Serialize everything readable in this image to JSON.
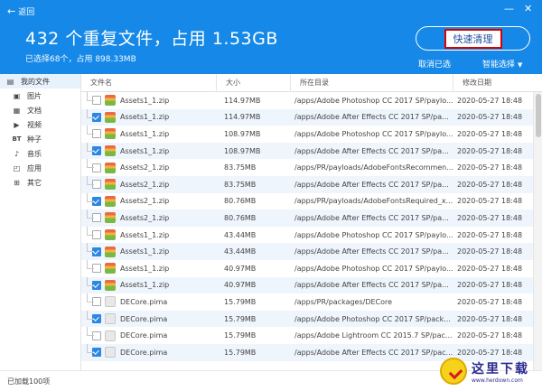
{
  "header": {
    "back_label": "返回",
    "title": "432 个重复文件，占用 1.53GB",
    "subtitle": "已选择68个，占用 898.33MB",
    "quick_clean_label": "快速清理",
    "cancel_selection_label": "取消已选",
    "smart_select_label": "智能选择",
    "window_controls": [
      "minimize-icon",
      "close-icon"
    ]
  },
  "sidebar": {
    "items": [
      {
        "icon": "my-files-icon",
        "label": "我的文件"
      },
      {
        "icon": "image-icon",
        "label": "图片"
      },
      {
        "icon": "document-icon",
        "label": "文档"
      },
      {
        "icon": "video-icon",
        "label": "视频"
      },
      {
        "icon": "bt-icon",
        "icon_text": "BT",
        "label": "种子"
      },
      {
        "icon": "music-icon",
        "label": "音乐"
      },
      {
        "icon": "app-icon",
        "label": "应用"
      },
      {
        "icon": "other-icon",
        "label": "其它"
      }
    ]
  },
  "table": {
    "columns": [
      "文件名",
      "大小",
      "所在目录",
      "修改日期"
    ],
    "rows": [
      {
        "name": "Assets1_1.zip",
        "size": "114.97MB",
        "path": "/apps/Adobe Photoshop CC 2017 SP/paylo...",
        "date": "2020-05-27 18:48",
        "checked": false,
        "type": "zip"
      },
      {
        "name": "Assets1_1.zip",
        "size": "114.97MB",
        "path": "/apps/Adobe After Effects CC 2017 SP/pa...",
        "date": "2020-05-27 18:48",
        "checked": true,
        "type": "zip"
      },
      {
        "name": "Assets1_1.zip",
        "size": "108.97MB",
        "path": "/apps/Adobe Photoshop CC 2017 SP/paylo...",
        "date": "2020-05-27 18:48",
        "checked": false,
        "type": "zip"
      },
      {
        "name": "Assets1_1.zip",
        "size": "108.97MB",
        "path": "/apps/Adobe After Effects CC 2017 SP/pa...",
        "date": "2020-05-27 18:48",
        "checked": true,
        "type": "zip"
      },
      {
        "name": "Assets2_1.zip",
        "size": "83.75MB",
        "path": "/apps/PR/payloads/AdobeFontsRecommen...",
        "date": "2020-05-27 18:48",
        "checked": false,
        "type": "zip"
      },
      {
        "name": "Assets2_1.zip",
        "size": "83.75MB",
        "path": "/apps/Adobe After Effects CC 2017 SP/pa...",
        "date": "2020-05-27 18:48",
        "checked": false,
        "type": "zip"
      },
      {
        "name": "Assets2_1.zip",
        "size": "80.76MB",
        "path": "/apps/PR/payloads/AdobeFontsRequired_x...",
        "date": "2020-05-27 18:48",
        "checked": true,
        "type": "zip"
      },
      {
        "name": "Assets2_1.zip",
        "size": "80.76MB",
        "path": "/apps/Adobe After Effects CC 2017 SP/pa...",
        "date": "2020-05-27 18:48",
        "checked": false,
        "type": "zip"
      },
      {
        "name": "Assets1_1.zip",
        "size": "43.44MB",
        "path": "/apps/Adobe Photoshop CC 2017 SP/paylo...",
        "date": "2020-05-27 18:48",
        "checked": false,
        "type": "zip"
      },
      {
        "name": "Assets1_1.zip",
        "size": "43.44MB",
        "path": "/apps/Adobe After Effects CC 2017 SP/pa...",
        "date": "2020-05-27 18:48",
        "checked": true,
        "type": "zip"
      },
      {
        "name": "Assets1_1.zip",
        "size": "40.97MB",
        "path": "/apps/Adobe Photoshop CC 2017 SP/paylo...",
        "date": "2020-05-27 18:48",
        "checked": false,
        "type": "zip"
      },
      {
        "name": "Assets1_1.zip",
        "size": "40.97MB",
        "path": "/apps/Adobe After Effects CC 2017 SP/pa...",
        "date": "2020-05-27 18:48",
        "checked": true,
        "type": "zip"
      },
      {
        "name": "DECore.pima",
        "size": "15.79MB",
        "path": "/apps/PR/packages/DECore",
        "date": "2020-05-27 18:48",
        "checked": false,
        "type": "pima"
      },
      {
        "name": "DECore.pima",
        "size": "15.79MB",
        "path": "/apps/Adobe Photoshop CC 2017 SP/pack...",
        "date": "2020-05-27 18:48",
        "checked": true,
        "type": "pima"
      },
      {
        "name": "DECore.pima",
        "size": "15.79MB",
        "path": "/apps/Adobe Lightroom CC 2015.7 SP/pac...",
        "date": "2020-05-27 18:48",
        "checked": false,
        "type": "pima"
      },
      {
        "name": "DECore.pima",
        "size": "15.79MB",
        "path": "/apps/Adobe After Effects CC 2017 SP/pac...",
        "date": "2020-05-27 18:48",
        "checked": true,
        "type": "pima"
      }
    ]
  },
  "footer": {
    "status": "已加载100项"
  },
  "watermark": {
    "text": "这里下载",
    "url": "www.herdown.com"
  },
  "colors": {
    "header_bg": "#1689e8",
    "checkbox_on": "#2c86e4",
    "row_alt": "#eef5fc",
    "highlight_border": "#d80000"
  }
}
